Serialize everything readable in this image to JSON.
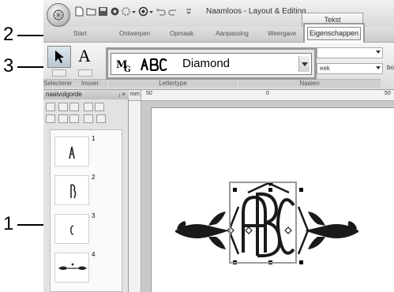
{
  "window": {
    "title": "Naamloos - Layout & Editing"
  },
  "tabs": {
    "contextual_group": "Tekst",
    "ribbon_tabs": [
      "Start",
      "Ontwerpen",
      "Opmaak",
      "Aanpassing",
      "Weergave"
    ],
    "active_tab": "Eigenschappen"
  },
  "ribbon": {
    "groups": {
      "selecteren": "Selecteren",
      "invoer": "Invoer",
      "lettertype": "Lettertype",
      "naaien": "Naaien"
    },
    "right_field_1": "",
    "right_field_2": "eek",
    "right_field_3": "bo",
    "font": {
      "name": "Diamond"
    }
  },
  "panel": {
    "title": "naaivolgorde",
    "controls": "ⱼ ×",
    "thumbnails": [
      {
        "num": "1",
        "glyph": "A"
      },
      {
        "num": "2",
        "glyph": "B"
      },
      {
        "num": "3",
        "glyph": "C"
      },
      {
        "num": "4",
        "glyph": ""
      }
    ]
  },
  "rulers": {
    "h_labels": [
      "50",
      "0",
      "50"
    ],
    "h_unit": "mm"
  },
  "callouts": [
    "1",
    "2",
    "3"
  ],
  "colors": {
    "accent": "#9a9a9a",
    "stitch": "#1a1a1a"
  }
}
